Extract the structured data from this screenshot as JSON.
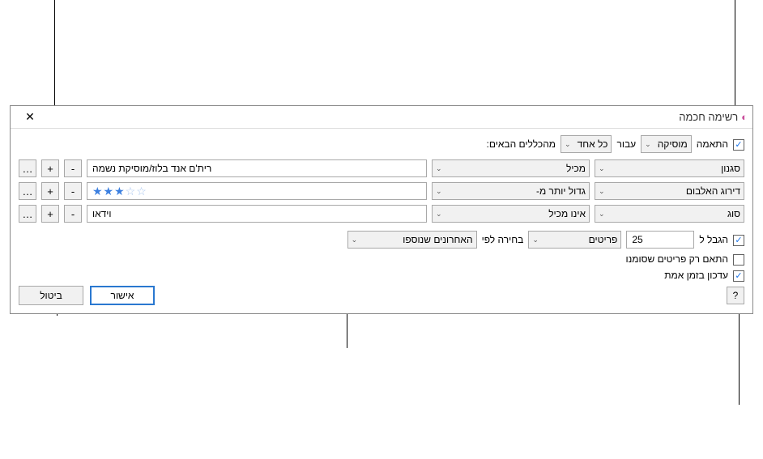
{
  "title": "רשימה חכמה",
  "toprow": {
    "match_label": "התאמה",
    "source": "מוסיקה",
    "for_label": "עבור",
    "match_mode": "כל אחד",
    "rules_suffix": "מהכללים הבאים:"
  },
  "rules": [
    {
      "field": "סגנון",
      "op": "מכיל",
      "value": "רית'ם אנד בלוז/מוסיקת נשמה",
      "type": "text"
    },
    {
      "field": "דירוג האלבום",
      "op": "גדול יותר מ-",
      "value": 3,
      "max": 5,
      "type": "stars"
    },
    {
      "field": "סוג",
      "op": "אינו מכיל",
      "value": "וידאו",
      "type": "text"
    }
  ],
  "limit": {
    "label": "הגבל ל",
    "count": "25",
    "unit": "פריטים",
    "by_label": "בחירה לפי",
    "by_value": "האחרונים שנוספו"
  },
  "match_checked_only": "התאם רק פריטים שסומנו",
  "live_update": "עדכון בזמן אמת",
  "buttons": {
    "ok": "אישור",
    "cancel": "ביטול",
    "help": "?"
  },
  "row_buttons": {
    "minus": "-",
    "plus": "+",
    "more": "…"
  }
}
